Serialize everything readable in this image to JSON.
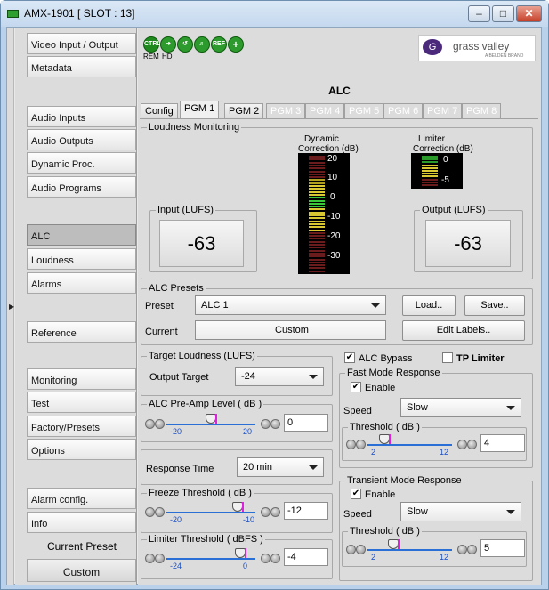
{
  "window": {
    "title": "AMX-1901 [ SLOT : 13]"
  },
  "status_icons": {
    "ctrl": "CTRL",
    "rem": "REM",
    "hd": "HD",
    "ref": "REF"
  },
  "logo": {
    "brand": "grass valley",
    "sub": "A BELDEN BRAND"
  },
  "nav": {
    "items": [
      {
        "label": "Video Input / Output"
      },
      {
        "label": "Metadata"
      },
      {
        "label": "Audio Inputs"
      },
      {
        "label": "Audio Outputs"
      },
      {
        "label": "Dynamic Proc."
      },
      {
        "label": "Audio Programs"
      },
      {
        "label": "ALC"
      },
      {
        "label": "Loudness"
      },
      {
        "label": "Alarms"
      },
      {
        "label": "Reference"
      },
      {
        "label": "Monitoring"
      },
      {
        "label": "Test"
      },
      {
        "label": "Factory/Presets"
      },
      {
        "label": "Options"
      },
      {
        "label": "Alarm config."
      },
      {
        "label": "Info"
      }
    ],
    "current_preset_label": "Current Preset",
    "current_preset_value": "Custom"
  },
  "page": {
    "title": "ALC"
  },
  "tabs": [
    "Config",
    "PGM 1",
    "PGM 2",
    "PGM 3",
    "PGM 4",
    "PGM 5",
    "PGM 6",
    "PGM 7",
    "PGM 8"
  ],
  "loudness": {
    "title": "Loudness Monitoring",
    "dynamic_label_1": "Dynamic",
    "dynamic_label_2": "Correction (dB)",
    "limiter_label_1": "Limiter",
    "limiter_label_2": "Correction (dB)",
    "dynamic_scale": [
      "20",
      "10",
      "0",
      "-10",
      "-20",
      "-30"
    ],
    "limiter_scale": [
      "0",
      "-5"
    ],
    "input_label": "Input (LUFS)",
    "input_value": "-63",
    "output_label": "Output (LUFS)",
    "output_value": "-63"
  },
  "presets": {
    "title": "ALC Presets",
    "preset_label": "Preset",
    "preset_value": "ALC 1",
    "current_label": "Current",
    "current_value": "Custom",
    "load": "Load..",
    "save": "Save..",
    "edit_labels": "Edit Labels.."
  },
  "target": {
    "title": "Target Loudness (LUFS)",
    "label": "Output Target",
    "value": "-24"
  },
  "preamp": {
    "title": "ALC Pre-Amp Level ( dB )",
    "min": "-20",
    "max": "20",
    "value": "0",
    "level": 0.5
  },
  "response": {
    "label": "Response Time",
    "value": "20 min"
  },
  "freeze": {
    "title": "Freeze Threshold ( dB )",
    "min": "-20",
    "max": "-10",
    "value": "-12",
    "level": 0.8
  },
  "limiter": {
    "title": "Limiter Threshold ( dBFS )",
    "min": "-24",
    "max": "0",
    "value": "-4",
    "level": 0.83
  },
  "bypass": {
    "alc_bypass": "ALC Bypass",
    "alc_bypass_checked": true,
    "tp_limiter": "TP Limiter",
    "tp_limiter_checked": false
  },
  "fast": {
    "title": "Fast Mode Response",
    "enable": "Enable",
    "speed_label": "Speed",
    "speed_value": "Slow",
    "thr_title": "Threshold ( dB )",
    "min": "2",
    "max": "12",
    "value": "4",
    "level": 0.2
  },
  "transient": {
    "title": "Transient Mode Response",
    "enable": "Enable",
    "speed_label": "Speed",
    "speed_value": "Slow",
    "thr_title": "Threshold ( dB )",
    "min": "2",
    "max": "12",
    "value": "5",
    "level": 0.3
  },
  "colors": {
    "accent_green": "#2c9a2c",
    "track_blue": "#2a6fd6",
    "thumb_marker": "#e020e0"
  }
}
